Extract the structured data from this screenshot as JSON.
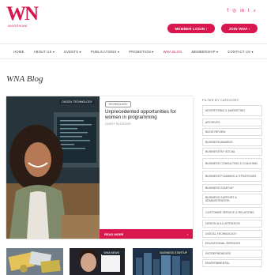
{
  "header": {
    "logo_text": "WN",
    "logo_sub": "WARRNAM",
    "social_icons": [
      "facebook-icon",
      "instagram-icon",
      "linkedin-icon",
      "twitter-icon",
      "search-icon"
    ],
    "social_glyphs": [
      "f",
      "◎",
      "in",
      "t",
      "⌕"
    ],
    "member_login": "MEMBER LOGIN ›",
    "join_now": "JOIN WNA ›"
  },
  "nav": {
    "items": [
      "HOME",
      "ABOUT US ▾",
      "EVENTS ▾",
      "PUBLICATIONS ▾",
      "PROMOTION ▾",
      "WNA BLOG",
      "MEMBERSHIP ▾",
      "CONTACT US ▾"
    ],
    "active_index": 5
  },
  "page": {
    "title": "WNA Blog"
  },
  "feature": {
    "image_tag": "DIGITAL TECHNOLOGY",
    "tag": "TECHNOLOGY",
    "title": "Unprecedented opportunities for women in programming",
    "author": "GUEST BLOGGER",
    "read_more": "READ MORE",
    "read_more_arrow": "›"
  },
  "sidebar": {
    "heading": "FILTER BY CATEGORY",
    "items": [
      "ADVERTISING & MARKETING",
      "ARCHIVES",
      "BOOK REVIEW",
      "BUSINESS AWARDS",
      "BUSINESS BY SOCIAL",
      "BUSINESS CONSULTING & COACHING",
      "BUSINESS PLANNING & STRATEGIES",
      "BUSINESS STARTUP",
      "BUSINESS SUPPORT & ADMINISTRATION",
      "CUSTOMER SERVICE & RELATIONS",
      "DESIGN & ILLUSTRATION",
      "DIGITAL TECHNOLOGY",
      "EDUCATIONAL SERVICES",
      "ENTREPRENEURS",
      "ENVIRONMENTAL"
    ]
  },
  "thumbnails": {
    "tags": [
      "",
      "WNA NEWS",
      "BUSINESS STARTUP"
    ]
  },
  "colors": {
    "brand": "#d8174f",
    "dark": "#1d2a33"
  }
}
